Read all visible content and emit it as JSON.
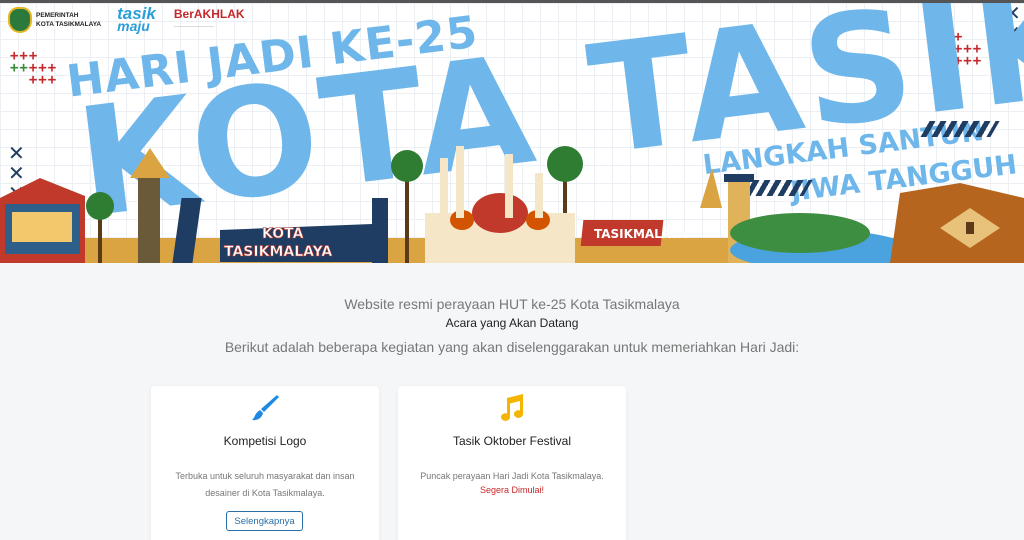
{
  "banner": {
    "logos": {
      "pemkot_line1": "PEMERINTAH",
      "pemkot_line2": "KOTA TASIKMALAYA",
      "tasikmaju_1": "tasik",
      "tasikmaju_2": "maju",
      "berakhlak": "BerAKHLAK"
    },
    "headline_small": "HARI JADI KE-25",
    "headline_big": "KOTA TASIK",
    "tagline_1": "LANGKAH SANTUN",
    "tagline_2": "JIWA TANGGUH",
    "sign_kota": "KOTA",
    "sign_tasikmalaya": "TASIKMALAYA",
    "sign_tasik": "TASIKMALAYA"
  },
  "main": {
    "subtitle": "Website resmi perayaan HUT ke-25 Kota Tasikmalaya",
    "section_title": "Acara yang Akan Datang",
    "section_desc": "Berikut adalah beberapa kegiatan yang akan diselenggarakan untuk memeriahkan Hari Jadi:"
  },
  "cards": [
    {
      "icon": "paintbrush-icon",
      "title": "Kompetisi Logo",
      "text": "Terbuka untuk seluruh masyarakat dan insan desainer di Kota Tasikmalaya.",
      "button": "Selengkapnya"
    },
    {
      "icon": "music-note-icon",
      "title": "Tasik Oktober Festival",
      "text": "Puncak perayaan Hari Jadi Kota Tasikmalaya.",
      "status": "Segera Dimulai!"
    }
  ],
  "colors": {
    "headline": "#6fb7ea",
    "accent_blue": "#2a6fa8",
    "status_red": "#c62828",
    "brush_blue": "#1e88e5",
    "note_yellow": "#f4b400"
  }
}
